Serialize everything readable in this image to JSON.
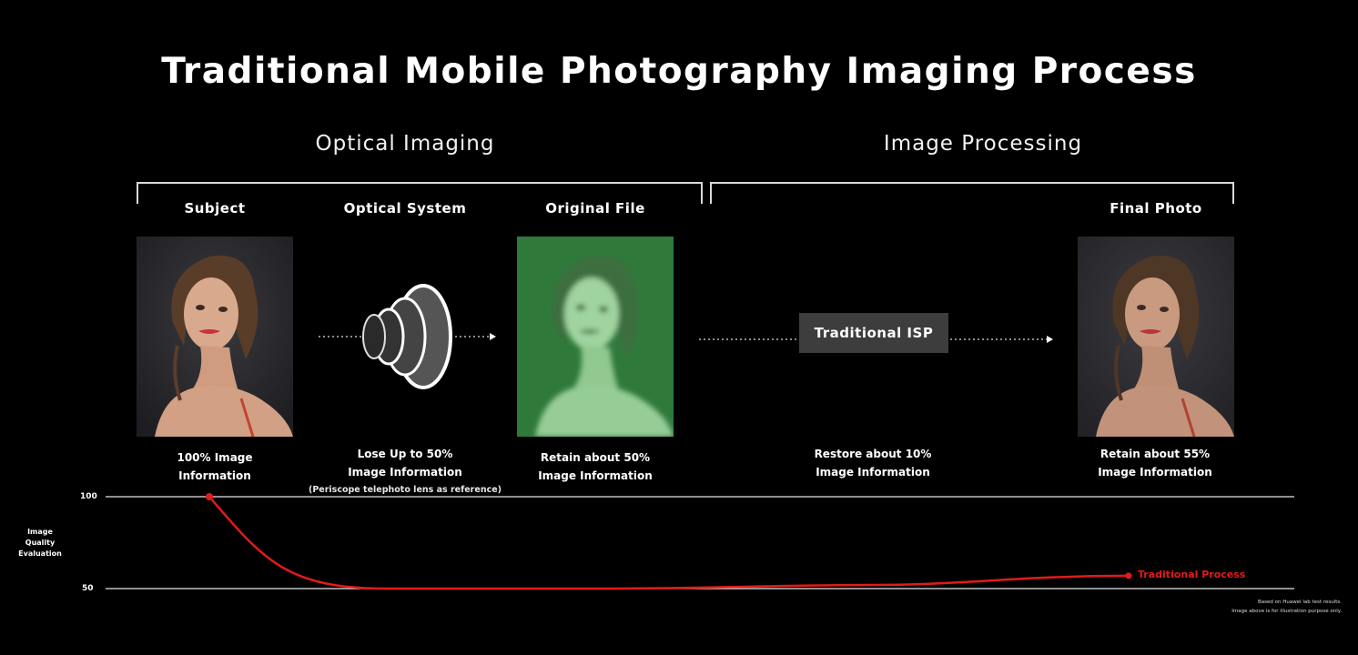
{
  "title": "Traditional Mobile Photography Imaging Process",
  "sections": {
    "optical": "Optical Imaging",
    "processing": "Image Processing"
  },
  "stages": {
    "subject": {
      "label": "Subject",
      "caption_line1": "100% Image",
      "caption_line2": "Information"
    },
    "optical_system": {
      "label": "Optical System",
      "caption_line1": "Lose Up to 50%",
      "caption_line2": "Image Information",
      "note": "(Periscope telephoto lens as reference)"
    },
    "original_file": {
      "label": "Original File",
      "caption_line1": "Retain about 50%",
      "caption_line2": "Image Information"
    },
    "isp": {
      "label": "Traditional ISP",
      "caption_line1": "Restore about 10%",
      "caption_line2": "Image Information"
    },
    "final_photo": {
      "label": "Final Photo",
      "caption_line1": "Retain about 55%",
      "caption_line2": "Image Information"
    }
  },
  "quality_chart": {
    "axis_label_line1": "Image",
    "axis_label_line2": "Quality",
    "axis_label_line3": "Evaluation",
    "tick_high": "100",
    "tick_low": "50",
    "y_values": [
      100,
      50
    ],
    "series_name": "Traditional Process",
    "series_color": "#e21b1b",
    "points": [
      {
        "stage": "Subject",
        "value": 100
      },
      {
        "stage": "Optical System",
        "value": 50
      },
      {
        "stage": "Original File",
        "value": 50
      },
      {
        "stage": "Traditional ISP",
        "value": 52
      },
      {
        "stage": "Final Photo",
        "value": 57
      }
    ]
  },
  "footnote": {
    "line1": "Based on Huawei lab test results.",
    "line2": "Image above is for illustration purpose only."
  },
  "colors": {
    "background": "#000000",
    "isp_box": "#3d3d3d",
    "raw_tint": "#2f7a3a",
    "accent": "#e21b1b"
  }
}
